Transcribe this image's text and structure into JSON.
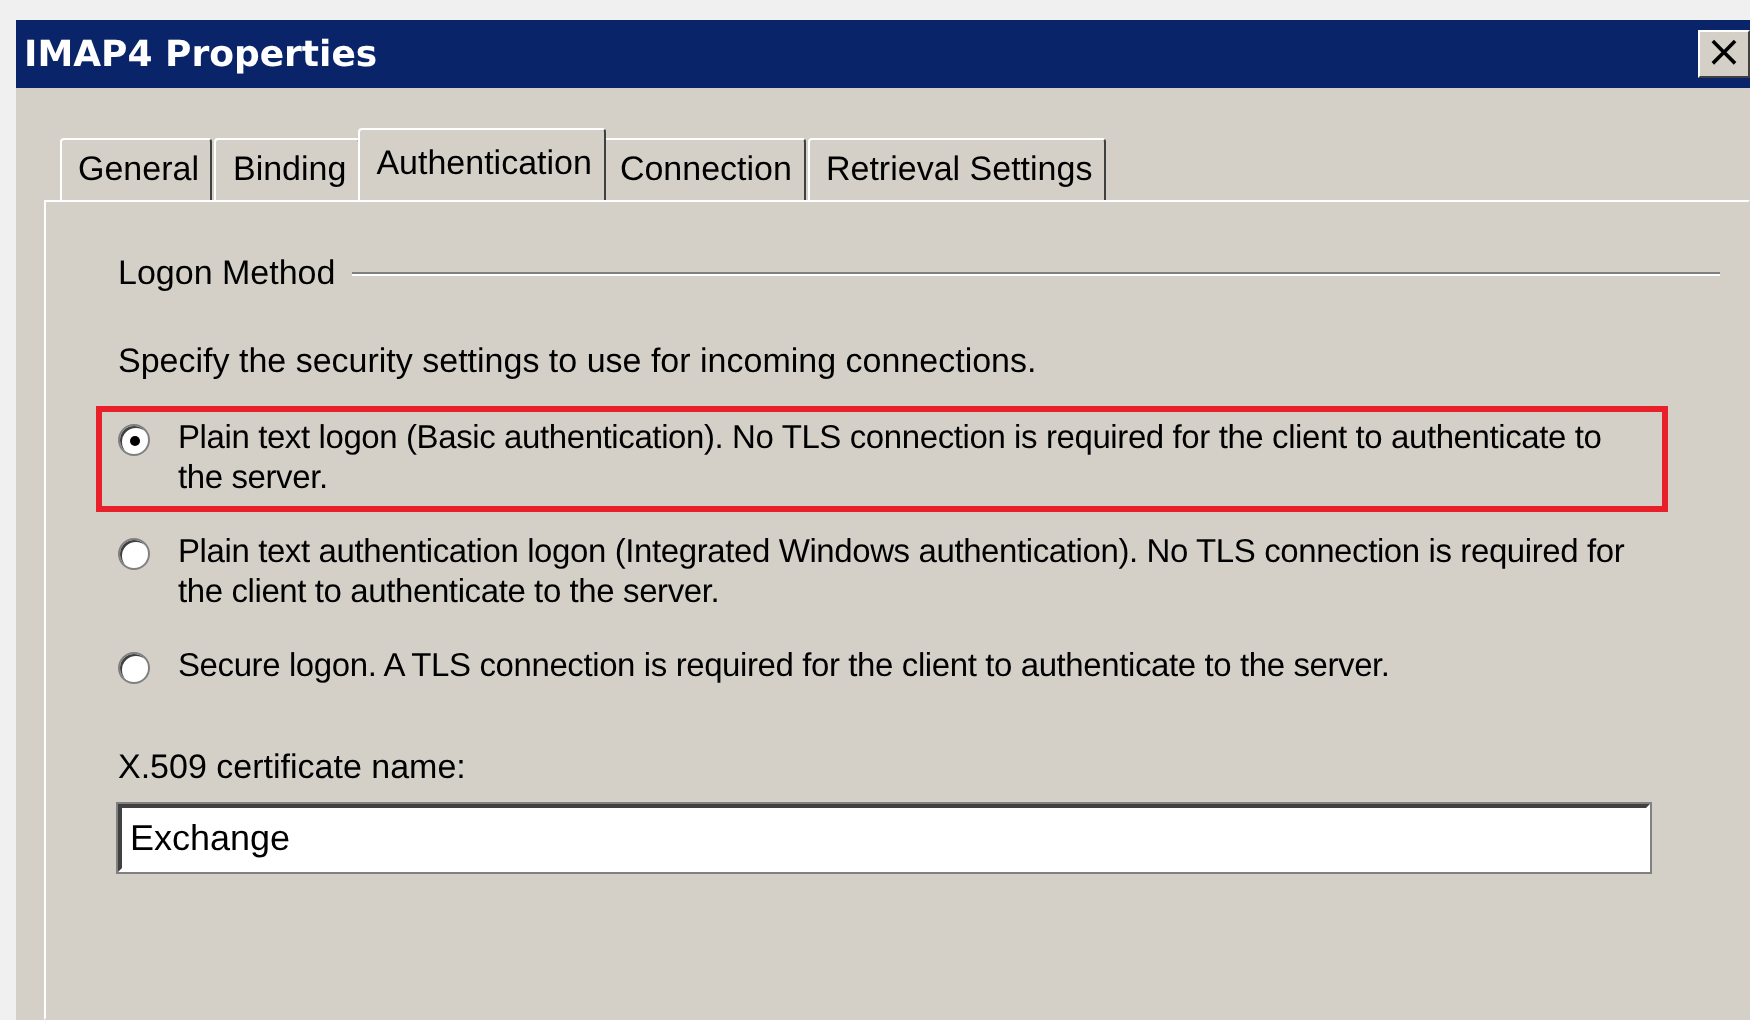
{
  "window": {
    "title": "IMAP4 Properties",
    "close": "×"
  },
  "tabs": [
    {
      "label": "General",
      "selected": false
    },
    {
      "label": "Binding",
      "selected": false
    },
    {
      "label": "Authentication",
      "selected": true
    },
    {
      "label": "Connection",
      "selected": false
    },
    {
      "label": "Retrieval Settings",
      "selected": false
    }
  ],
  "group": {
    "title": "Logon Method",
    "instructions": "Specify the security settings to use for incoming connections.",
    "options": [
      {
        "label": "Plain text logon (Basic authentication). No TLS connection is required for the client to authenticate to the server.",
        "selected": true,
        "highlighted": true
      },
      {
        "label": "Plain text authentication logon (Integrated Windows authentication). No TLS connection is required for the client to authenticate to the server.",
        "selected": false,
        "highlighted": false
      },
      {
        "label": "Secure logon. A TLS connection is required for the client to authenticate to the server.",
        "selected": false,
        "highlighted": false
      }
    ]
  },
  "certificate": {
    "label": "X.509 certificate name:",
    "value": "Exchange"
  }
}
